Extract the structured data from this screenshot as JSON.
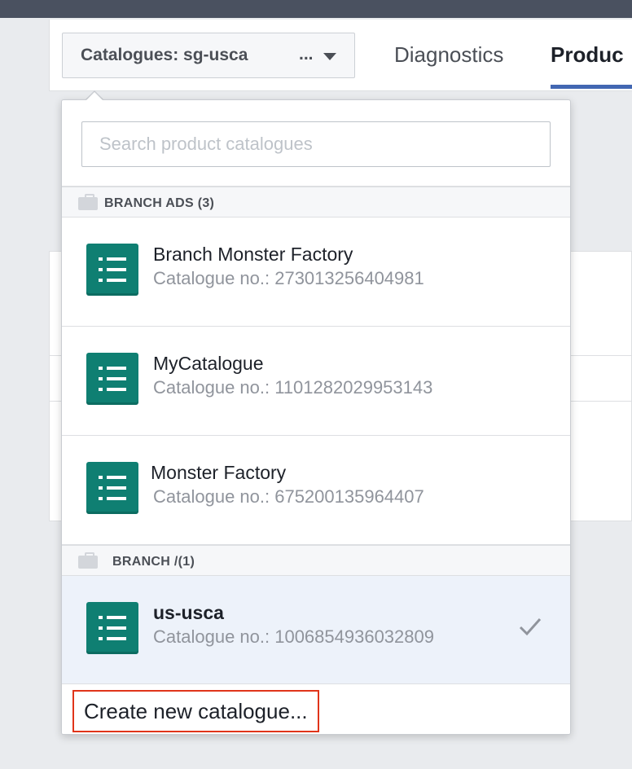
{
  "header": {
    "catalogue_button_label": "Catalogues: sg-usca",
    "catalogue_button_ellipsis": "...",
    "tabs": [
      {
        "label": "Diagnostics"
      },
      {
        "label": "Produc"
      }
    ]
  },
  "dropdown": {
    "search_placeholder": "Search product catalogues",
    "sections": [
      {
        "title": "BRANCH ADS (3)",
        "items": [
          {
            "name": "Branch Monster Factory",
            "number": "Catalogue no.: 273013256404981"
          },
          {
            "name": "MyCatalogue",
            "number": "Catalogue no.: 1101282029953143"
          },
          {
            "name": "Monster Factory",
            "number": "Catalogue no.: 675200135964407"
          }
        ]
      },
      {
        "title": "BRANCH /(1)",
        "items": [
          {
            "name": "us-usca",
            "number": "Catalogue no.: 1006854936032809",
            "selected": true
          }
        ]
      }
    ],
    "create_label": "Create new catalogue..."
  },
  "colors": {
    "catalogue_icon": "#0f7f72",
    "selected_row": "#edf2fa",
    "highlight_border": "#e0341a",
    "tab_underline": "#4267b2"
  }
}
